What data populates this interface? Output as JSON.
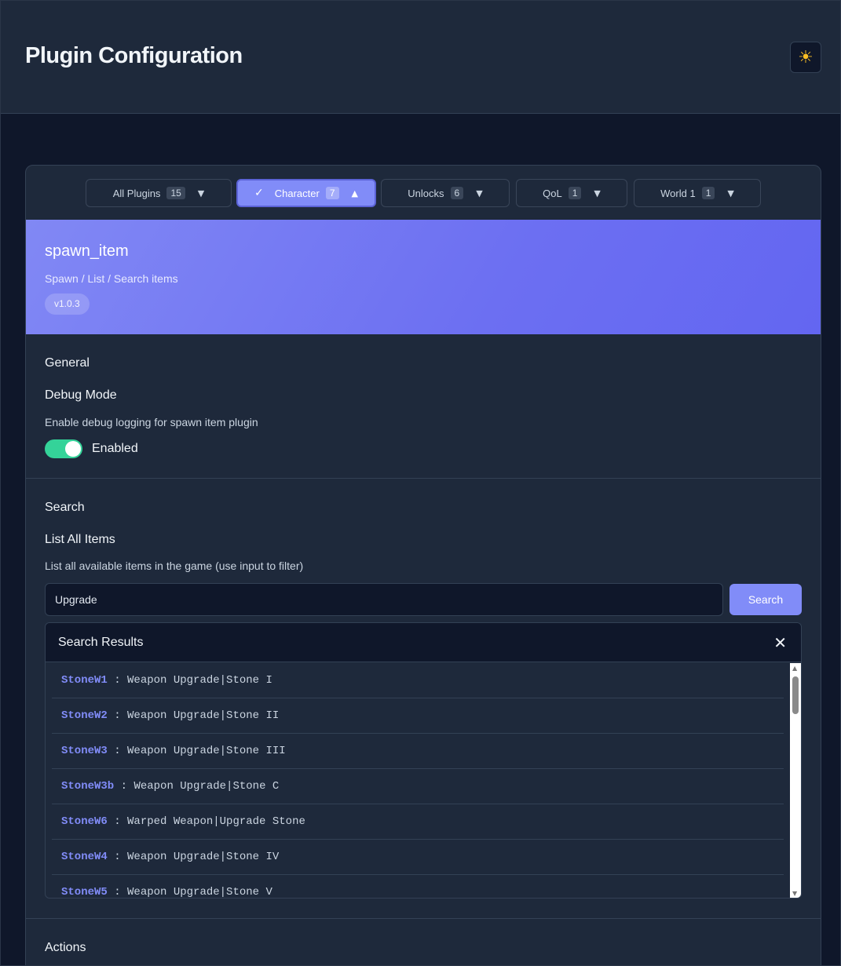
{
  "header": {
    "title": "Plugin Configuration",
    "theme_toggle_icon": "sun-icon",
    "theme_toggle_glyph": "☀"
  },
  "tabs": [
    {
      "label": "All Plugins",
      "count": "15",
      "active": false,
      "caret": "▼"
    },
    {
      "label": "Character",
      "count": "7",
      "active": true,
      "caret": "▲",
      "check": "✓"
    },
    {
      "label": "Unlocks",
      "count": "6",
      "active": false,
      "caret": "▼"
    },
    {
      "label": "QoL",
      "count": "1",
      "active": false,
      "caret": "▼"
    },
    {
      "label": "World 1",
      "count": "1",
      "active": false,
      "caret": "▼"
    }
  ],
  "plugin": {
    "name": "spawn_item",
    "description": "Spawn / List / Search items",
    "version": "v1.0.3",
    "accent_color": "#6366f1"
  },
  "general": {
    "title": "General",
    "debug": {
      "title": "Debug Mode",
      "description": "Enable debug logging for spawn item plugin",
      "enabled": true,
      "toggle_label": "Enabled",
      "toggle_color": "#34d399"
    }
  },
  "search": {
    "title": "Search",
    "list_all": {
      "title": "List All Items",
      "description": "List all available items in the game (use input to filter)",
      "input_value": "Upgrade",
      "button_label": "Search"
    },
    "results": {
      "title": "Search Results",
      "close_glyph": "✕",
      "items": [
        {
          "id": "StoneW1",
          "name": "Weapon Upgrade|Stone I"
        },
        {
          "id": "StoneW2",
          "name": "Weapon Upgrade|Stone II"
        },
        {
          "id": "StoneW3",
          "name": "Weapon Upgrade|Stone III"
        },
        {
          "id": "StoneW3b",
          "name": "Weapon Upgrade|Stone C"
        },
        {
          "id": "StoneW6",
          "name": "Warped Weapon|Upgrade Stone"
        },
        {
          "id": "StoneW4",
          "name": "Weapon Upgrade|Stone IV"
        },
        {
          "id": "StoneW5",
          "name": "Weapon Upgrade|Stone V"
        }
      ],
      "separator": " : "
    }
  },
  "actions": {
    "title": "Actions"
  }
}
